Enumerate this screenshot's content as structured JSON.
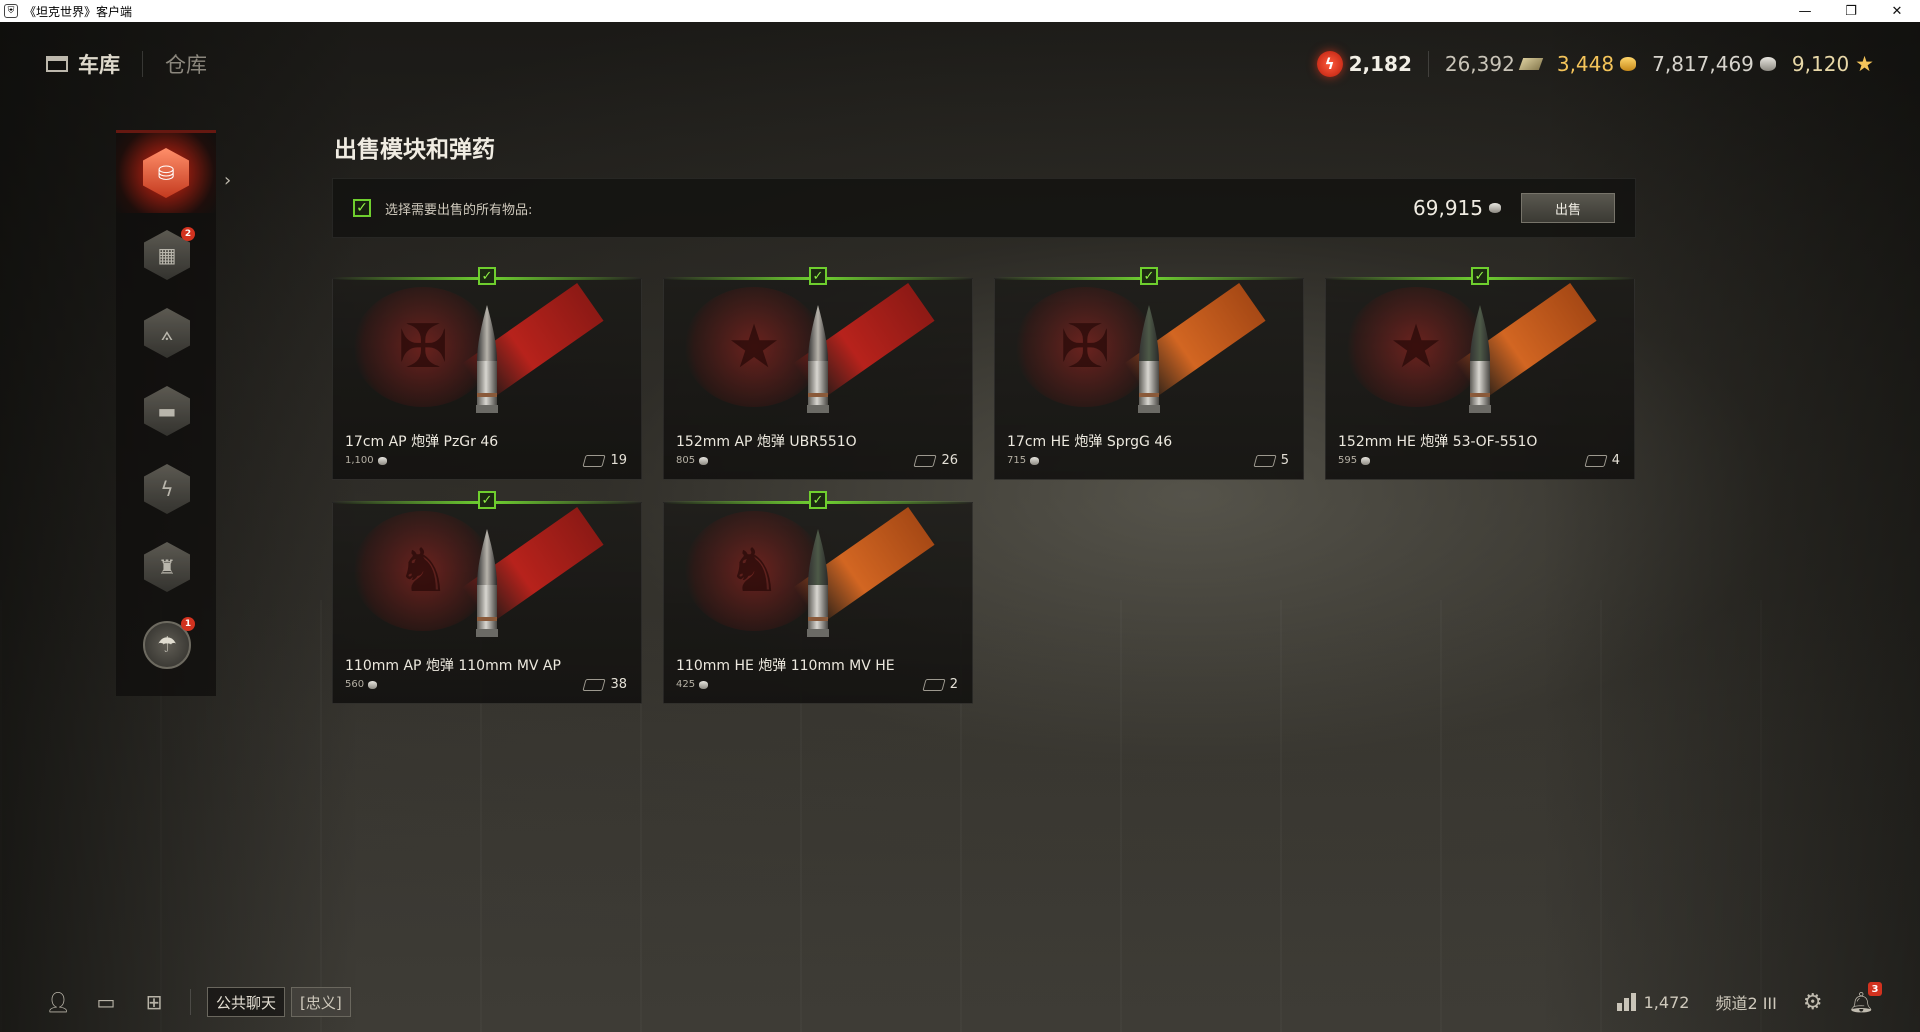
{
  "window": {
    "title": "《坦克世界》客户端",
    "controls": [
      "minimize",
      "restore",
      "close"
    ]
  },
  "nav": {
    "garage": "车库",
    "depot": "仓库"
  },
  "currencies": {
    "free_xp": "2,182",
    "bonds": "26,392",
    "gold": "3,448",
    "credits": "7,817,469",
    "crew_xp": "9,120"
  },
  "sidebar": {
    "items": [
      {
        "icon": "shells-stack-icon",
        "active": true
      },
      {
        "icon": "boxes-icon",
        "badge": "2"
      },
      {
        "icon": "compass-icon"
      },
      {
        "icon": "tank-icon"
      },
      {
        "icon": "lightning-icon"
      },
      {
        "icon": "torch-icon"
      },
      {
        "icon": "parachute-icon",
        "badge": "1"
      }
    ]
  },
  "panel": {
    "title": "出售模块和弹药",
    "select_all_label": "选择需要出售的所有物品:",
    "total": "69,915",
    "sell_button": "出售"
  },
  "items": [
    {
      "name": "17cm AP 炮弹 PzGr 46",
      "price": "1,100",
      "count": "19",
      "emblem": "✠",
      "stripe": "red",
      "tip": "#b7b3ab",
      "checked": true
    },
    {
      "name": "152mm AP 炮弹 UBR551O",
      "price": "805",
      "count": "26",
      "emblem": "★",
      "stripe": "red",
      "tip": "#b7b3ab",
      "checked": true
    },
    {
      "name": "17cm HE 炮弹 SprgG 46",
      "price": "715",
      "count": "5",
      "emblem": "✠",
      "stripe": "orange",
      "tip": "#4e5a48",
      "checked": true
    },
    {
      "name": "152mm HE 炮弹 53-OF-551O",
      "price": "595",
      "count": "4",
      "emblem": "★",
      "stripe": "orange",
      "tip": "#4e5a48",
      "checked": true
    },
    {
      "name": "110mm AP 炮弹 110mm MV AP",
      "price": "560",
      "count": "38",
      "emblem": "♞",
      "stripe": "red",
      "tip": "#b7b3ab",
      "checked": true
    },
    {
      "name": "110mm HE 炮弹 110mm MV HE",
      "price": "425",
      "count": "2",
      "emblem": "♞",
      "stripe": "orange",
      "tip": "#4e5a48",
      "checked": true
    }
  ],
  "bottom": {
    "public_chat": "公共聊天",
    "clan_chat": "[忠义]",
    "online": "1,472",
    "channel": "频道2 III",
    "notifications": "3"
  }
}
